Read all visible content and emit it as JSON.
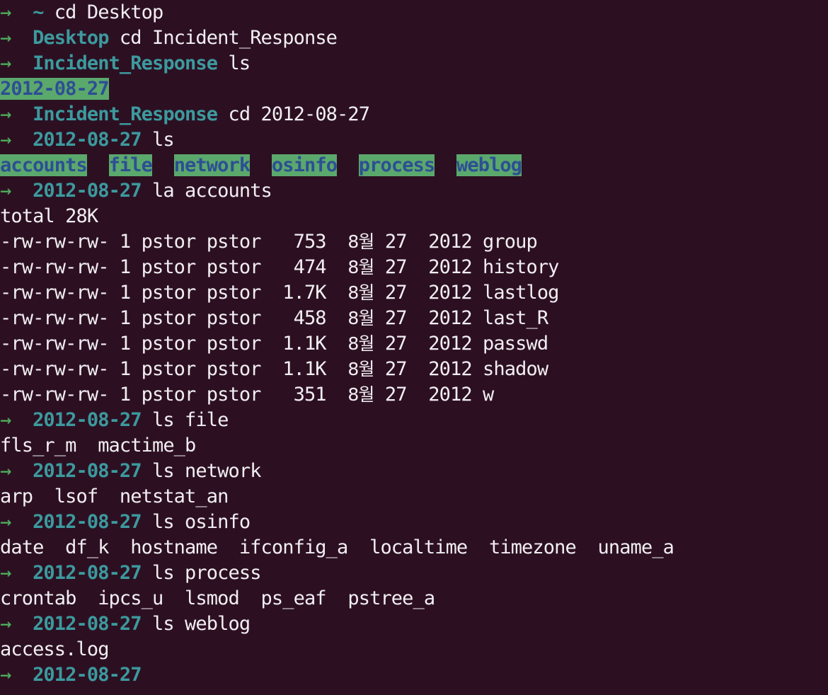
{
  "terminal": {
    "background_color": "#2c1022",
    "foreground_color": "#f2eef2",
    "prompt_arrow_color": "#4fb45f",
    "path_color": "#3c9a9e",
    "dir_bg_color": "#5ba86d",
    "dir_fg_color": "#2d4f93",
    "prompt_arrow": "→",
    "font_size_px": 27,
    "line_height_px": 36
  },
  "session": {
    "user": "pstor",
    "group": "pstor",
    "case_directory": "2012-08-27",
    "parent_directory": "Incident_Response"
  },
  "lines": [
    {
      "id": "line-01",
      "type": "prompt",
      "arrow": "→",
      "path": "~",
      "command": "cd Desktop"
    },
    {
      "id": "line-02",
      "type": "prompt",
      "arrow": "→",
      "path": "Desktop",
      "command": "cd Incident_Response"
    },
    {
      "id": "line-03",
      "type": "prompt",
      "arrow": "→",
      "path": "Incident_Response",
      "command": "ls"
    },
    {
      "id": "line-04",
      "type": "dir-listing",
      "entries": [
        "2012-08-27"
      ]
    },
    {
      "id": "line-05",
      "type": "prompt",
      "arrow": "→",
      "path": "Incident_Response",
      "command": "cd 2012-08-27"
    },
    {
      "id": "line-06",
      "type": "prompt",
      "arrow": "→",
      "path": "2012-08-27",
      "command": "ls"
    },
    {
      "id": "line-07",
      "type": "dir-listing",
      "entries": [
        "accounts",
        "file",
        "network",
        "osinfo",
        "process",
        "weblog"
      ]
    },
    {
      "id": "line-08",
      "type": "prompt",
      "arrow": "→",
      "path": "2012-08-27",
      "command": "la accounts"
    },
    {
      "id": "line-09",
      "type": "output",
      "text": "total 28K"
    },
    {
      "id": "line-10",
      "type": "ls-long",
      "perms": "-rw-rw-rw-",
      "links": "1",
      "owner": "pstor",
      "group": "pstor",
      "size": "753",
      "month": "8월",
      "day": "27",
      "year": "2012",
      "name": "group"
    },
    {
      "id": "line-11",
      "type": "ls-long",
      "perms": "-rw-rw-rw-",
      "links": "1",
      "owner": "pstor",
      "group": "pstor",
      "size": "474",
      "month": "8월",
      "day": "27",
      "year": "2012",
      "name": "history"
    },
    {
      "id": "line-12",
      "type": "ls-long",
      "perms": "-rw-rw-rw-",
      "links": "1",
      "owner": "pstor",
      "group": "pstor",
      "size": "1.7K",
      "month": "8월",
      "day": "27",
      "year": "2012",
      "name": "lastlog"
    },
    {
      "id": "line-13",
      "type": "ls-long",
      "perms": "-rw-rw-rw-",
      "links": "1",
      "owner": "pstor",
      "group": "pstor",
      "size": "458",
      "month": "8월",
      "day": "27",
      "year": "2012",
      "name": "last_R"
    },
    {
      "id": "line-14",
      "type": "ls-long",
      "perms": "-rw-rw-rw-",
      "links": "1",
      "owner": "pstor",
      "group": "pstor",
      "size": "1.1K",
      "month": "8월",
      "day": "27",
      "year": "2012",
      "name": "passwd"
    },
    {
      "id": "line-15",
      "type": "ls-long",
      "perms": "-rw-rw-rw-",
      "links": "1",
      "owner": "pstor",
      "group": "pstor",
      "size": "1.1K",
      "month": "8월",
      "day": "27",
      "year": "2012",
      "name": "shadow"
    },
    {
      "id": "line-16",
      "type": "ls-long",
      "perms": "-rw-rw-rw-",
      "links": "1",
      "owner": "pstor",
      "group": "pstor",
      "size": "351",
      "month": "8월",
      "day": "27",
      "year": "2012",
      "name": "w"
    },
    {
      "id": "line-17",
      "type": "prompt",
      "arrow": "→",
      "path": "2012-08-27",
      "command": "ls file"
    },
    {
      "id": "line-18",
      "type": "output",
      "text": "fls_r_m  mactime_b"
    },
    {
      "id": "line-19",
      "type": "prompt",
      "arrow": "→",
      "path": "2012-08-27",
      "command": "ls network"
    },
    {
      "id": "line-20",
      "type": "output",
      "text": "arp  lsof  netstat_an"
    },
    {
      "id": "line-21",
      "type": "prompt",
      "arrow": "→",
      "path": "2012-08-27",
      "command": "ls osinfo"
    },
    {
      "id": "line-22",
      "type": "output",
      "text": "date  df_k  hostname  ifconfig_a  localtime  timezone  uname_a"
    },
    {
      "id": "line-23",
      "type": "prompt",
      "arrow": "→",
      "path": "2012-08-27",
      "command": "ls process"
    },
    {
      "id": "line-24",
      "type": "output",
      "text": "crontab  ipcs_u  lsmod  ps_eaf  pstree_a"
    },
    {
      "id": "line-25",
      "type": "prompt",
      "arrow": "→",
      "path": "2012-08-27",
      "command": "ls weblog"
    },
    {
      "id": "line-26",
      "type": "output",
      "text": "access.log"
    },
    {
      "id": "line-27",
      "type": "prompt",
      "arrow": "→",
      "path": "2012-08-27",
      "command": ""
    }
  ]
}
